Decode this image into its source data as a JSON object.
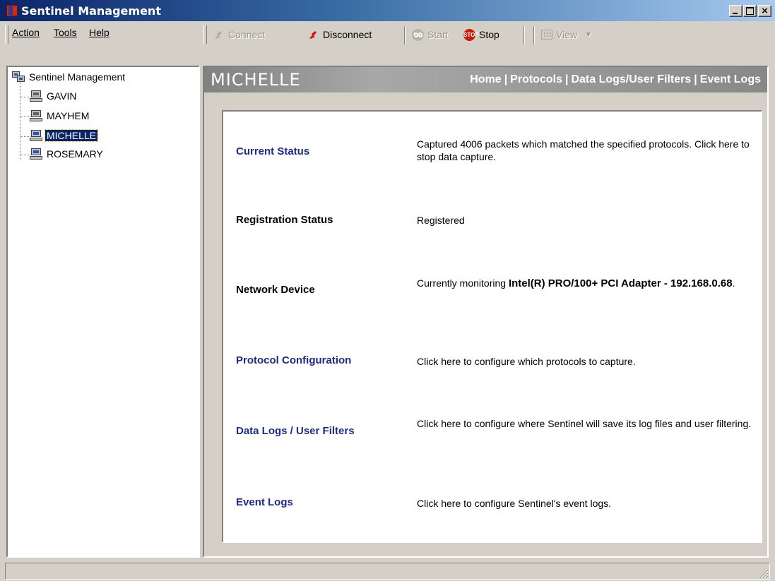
{
  "window": {
    "title": "Sentinel Management"
  },
  "menu": {
    "action": "Action",
    "tools": "Tools",
    "help": "Help"
  },
  "toolbar": {
    "connect": "Connect",
    "disconnect": "Disconnect",
    "start": "Start",
    "stop": "Stop",
    "view": "View",
    "start_badge": "GO",
    "stop_badge": "STOP"
  },
  "tree": {
    "root": "Sentinel Management",
    "nodes": [
      "GAVIN",
      "MAYHEM",
      "MICHELLE",
      "ROSEMARY"
    ],
    "selected": "MICHELLE"
  },
  "pane": {
    "title": "MICHELLE",
    "nav": [
      "Home",
      "Protocols",
      "Data Logs/User Filters",
      "Event Logs"
    ],
    "nav_separator": "|"
  },
  "rows": [
    {
      "label": "Current Status",
      "value": "Captured 4006 packets which matched the specified protocols. Click here to stop data capture."
    },
    {
      "label": "Registration Status",
      "value": "Registered"
    },
    {
      "label": "Network Device",
      "value_prefix": "Currently monitoring ",
      "value_bold": "Intel(R) PRO/100+ PCI Adapter - 192.168.0.68",
      "value_suffix": "."
    },
    {
      "label": "Protocol Configuration",
      "value": "Click here to configure which protocols to capture."
    },
    {
      "label": "Data Logs / User Filters",
      "value": "Click here to configure where Sentinel will save its log files and user filtering."
    },
    {
      "label": "Event Logs",
      "value": "Click here to configure Sentinel's event logs."
    }
  ],
  "colors": {
    "link": "#1b2a8c",
    "titlebar": "#0a246a",
    "selection": "#0a246a",
    "stop": "#c81d08"
  }
}
